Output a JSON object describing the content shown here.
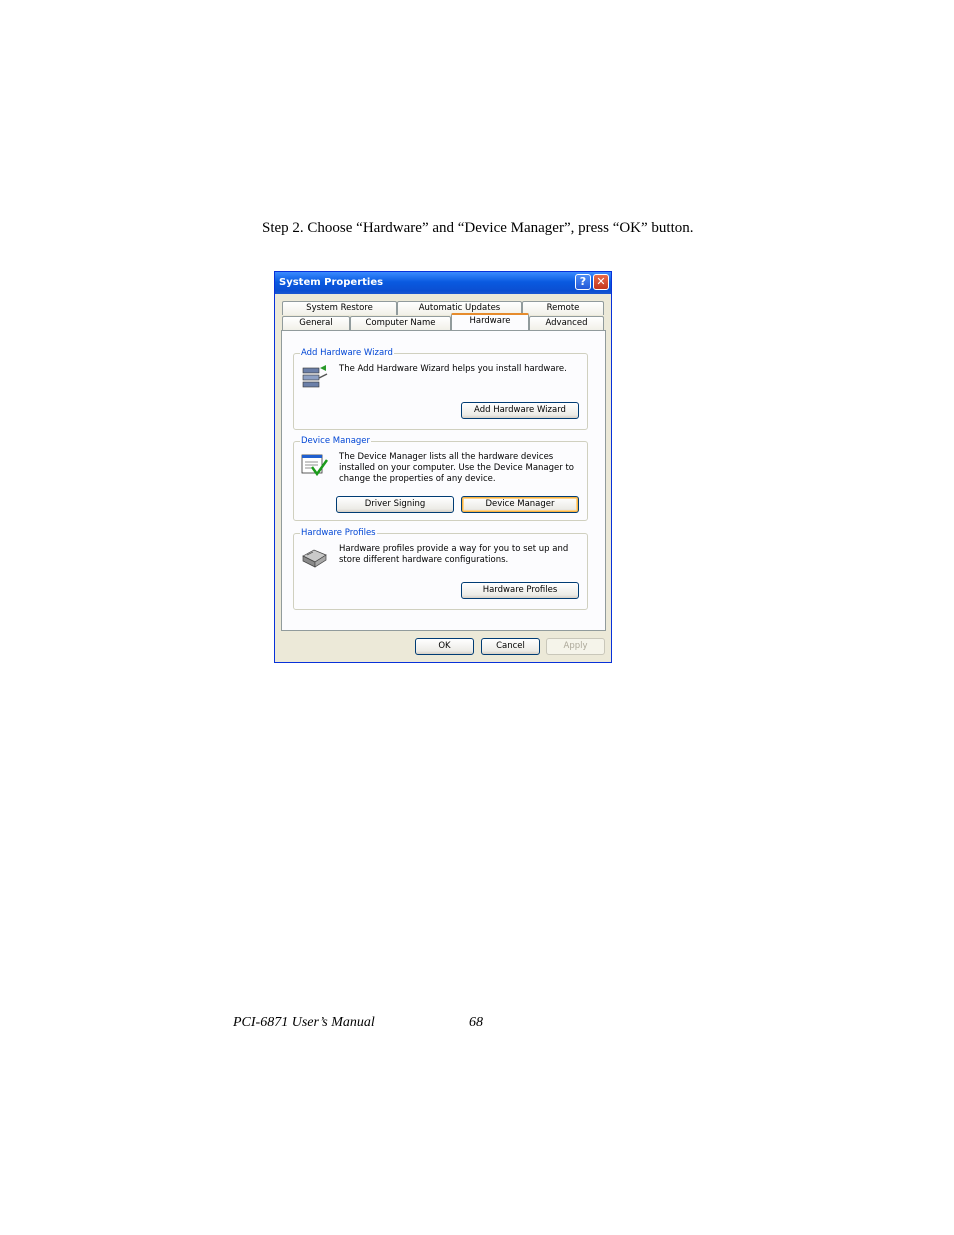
{
  "document": {
    "step_text": "Step 2.  Choose “Hardware” and “Device Manager”, press “OK” button.",
    "footer_title": "PCI-6871 User’s Manual",
    "footer_page": "68"
  },
  "dialog": {
    "title": "System Properties",
    "help_symbol": "?",
    "close_symbol": "✕",
    "tabs_row1": [
      "System Restore",
      "Automatic Updates",
      "Remote"
    ],
    "tabs_row2": [
      "General",
      "Computer Name",
      "Hardware",
      "Advanced"
    ],
    "active_tab": "Hardware",
    "groups": {
      "add_hardware": {
        "label": "Add Hardware Wizard",
        "text": "The Add Hardware Wizard helps you install hardware.",
        "button": "Add Hardware Wizard",
        "icon": "hardware-wizard-icon"
      },
      "device_manager": {
        "label": "Device Manager",
        "text": "The Device Manager lists all the hardware devices installed on your computer. Use the Device Manager to change the properties of any device.",
        "button_left": "Driver Signing",
        "button_right": "Device Manager",
        "icon": "device-manager-icon"
      },
      "hardware_profiles": {
        "label": "Hardware Profiles",
        "text": "Hardware profiles provide a way for you to set up and store different hardware configurations.",
        "button": "Hardware Profiles",
        "icon": "hardware-profiles-icon"
      }
    },
    "footer_buttons": {
      "ok": "OK",
      "cancel": "Cancel",
      "apply": "Apply"
    }
  }
}
